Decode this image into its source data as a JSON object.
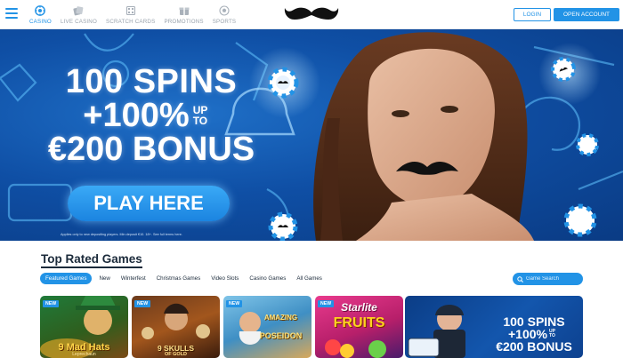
{
  "nav": {
    "items": [
      {
        "label": "CASINO",
        "icon": "casino-chip-icon",
        "active": true
      },
      {
        "label": "LIVE CASINO",
        "icon": "live-casino-icon",
        "active": false
      },
      {
        "label": "SCRATCH CARDS",
        "icon": "scratch-card-icon",
        "active": false
      },
      {
        "label": "PROMOTIONS",
        "icon": "promotions-icon",
        "active": false
      },
      {
        "label": "SPORTS",
        "icon": "sports-ball-icon",
        "active": false
      }
    ],
    "logo": "mustache-logo",
    "login_label": "LOGIN",
    "open_account_label": "OPEN ACCOUNT"
  },
  "hero": {
    "line1": "100 SPINS",
    "line2": "+100%",
    "upto": "UP TO",
    "line3": "€200 BONUS",
    "cta_label": "PLAY HERE",
    "terms": "Applies only to new depositing players. Min deposit €10. 18+. See full terms here."
  },
  "games": {
    "title": "Top Rated Games",
    "filters": [
      "Featured Games",
      "New",
      "Winterfest",
      "Christmas Games",
      "Video Slots",
      "Casino Games",
      "All Games"
    ],
    "active_filter": "Featured Games",
    "search_placeholder": "Game Search",
    "tiles": [
      {
        "badge": "NEW",
        "name": "9 Mad Hats",
        "sub": "Leprechaun"
      },
      {
        "badge": "NEW",
        "name": "9 SKULLS",
        "sub": "OF GOLD"
      },
      {
        "badge": "NEW",
        "name": "AMAZING",
        "sub": "POSEIDON"
      },
      {
        "badge": "NEW",
        "name": "Starlite",
        "sub": "FRUITS"
      }
    ],
    "promo": {
      "line1": "100 SPINS",
      "line2": "+100%",
      "upto": "UP TO",
      "line3": "€200 BONUS"
    }
  },
  "colors": {
    "accent": "#2293e6",
    "hero_bg": "#0f4fa5",
    "heading": "#1b2a3a"
  }
}
